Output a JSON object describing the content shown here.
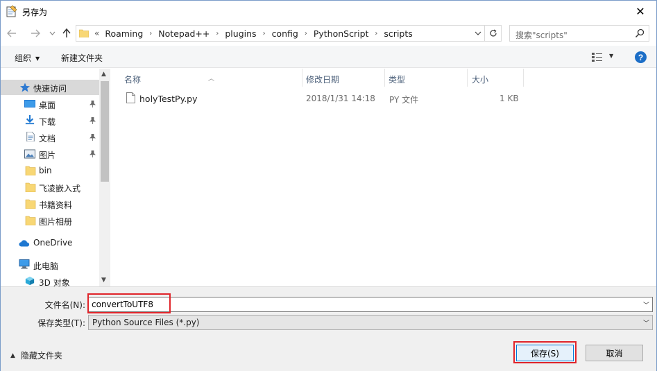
{
  "window": {
    "title": "另存为",
    "close_glyph": "✕"
  },
  "address": {
    "overflow": "«",
    "crumbs": [
      "Roaming",
      "Notepad++",
      "plugins",
      "config",
      "PythonScript",
      "scripts"
    ],
    "sep": "›"
  },
  "search": {
    "placeholder": "搜索\"scripts\""
  },
  "toolbar": {
    "organize": "组织",
    "new_folder": "新建文件夹"
  },
  "nav": {
    "quick_access": "快速访问",
    "items": [
      {
        "label": "桌面",
        "icon": "desktop-icon",
        "pinned": true
      },
      {
        "label": "下载",
        "icon": "download-icon",
        "pinned": true
      },
      {
        "label": "文档",
        "icon": "document-icon",
        "pinned": true
      },
      {
        "label": "图片",
        "icon": "picture-icon",
        "pinned": true
      },
      {
        "label": "bin",
        "icon": "folder-icon",
        "pinned": false
      },
      {
        "label": "飞凌嵌入式",
        "icon": "folder-icon",
        "pinned": false
      },
      {
        "label": "书籍资料",
        "icon": "folder-icon",
        "pinned": false
      },
      {
        "label": "图片相册",
        "icon": "folder-icon",
        "pinned": false
      }
    ],
    "onedrive": "OneDrive",
    "this_pc": "此电脑",
    "objects_3d": "3D 对象"
  },
  "columns": {
    "name": "名称",
    "date": "修改日期",
    "type": "类型",
    "size": "大小"
  },
  "files": [
    {
      "name": "holyTestPy.py",
      "date": "2018/1/31 14:18",
      "type": "PY 文件",
      "size": "1 KB"
    }
  ],
  "form": {
    "filename_label": "文件名(N):",
    "filename_value": "convertToUTF8",
    "filetype_label": "保存类型(T):",
    "filetype_value": "Python Source Files (*.py)",
    "hide_folders": "隐藏文件夹",
    "save": "保存(S)",
    "cancel": "取消"
  },
  "colors": {
    "accent": "#0078d7",
    "highlight_red": "#e0242a",
    "help_blue": "#1c6ec7",
    "folder_yellow": "#f8d775"
  }
}
